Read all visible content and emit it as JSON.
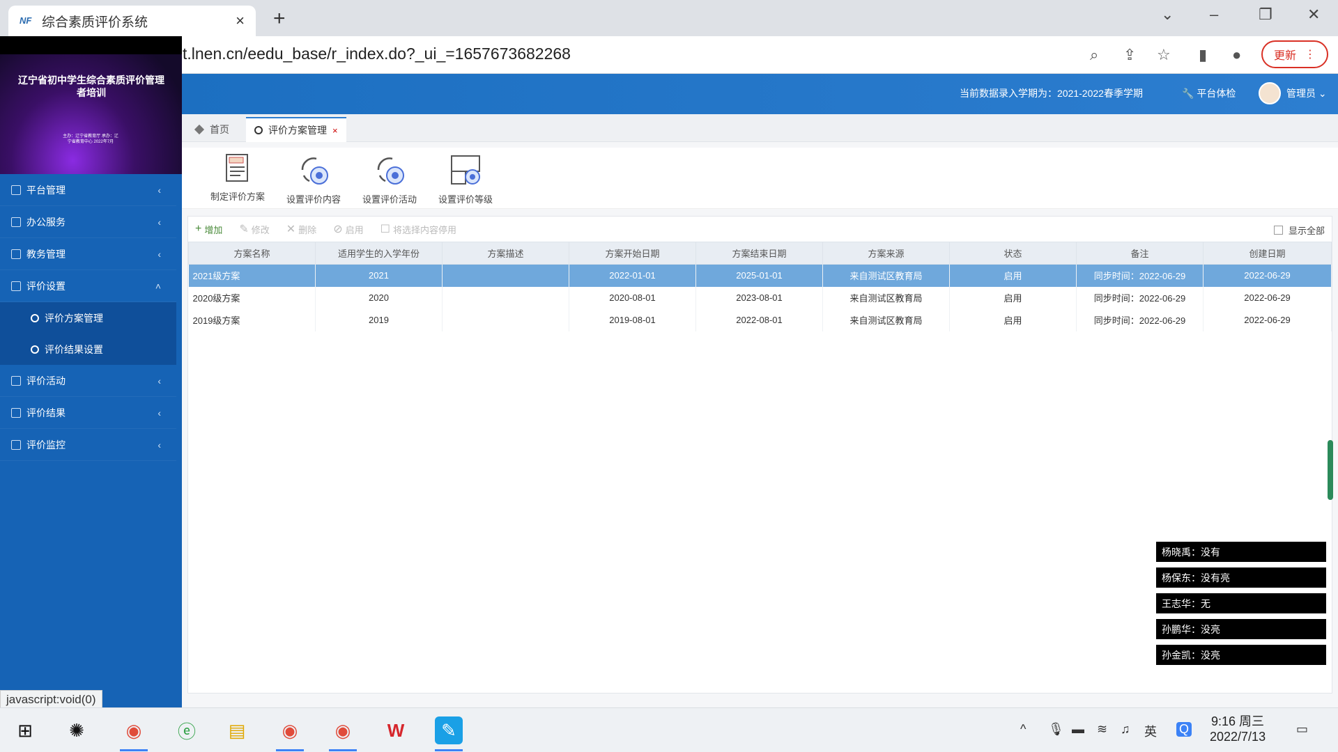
{
  "browser": {
    "tab_title": "综合素质评价系统",
    "tab_close": "×",
    "new_tab": "+",
    "url": "t.lnen.cn/eedu_base/r_index.do?_ui_=1657673682268",
    "update_label": "更新"
  },
  "video": {
    "title": "辽宁省初中学生综合素质评价管理者培训",
    "subtitle": "主办：辽宁省教育厅 承办：辽宁省教育中心 2022年7月"
  },
  "header": {
    "term_text": "当前数据录入学期为：2021-2022春季学期",
    "check_label": "平台体检",
    "user_label": "管理员"
  },
  "sidebar": {
    "items": [
      {
        "label": "平台管理",
        "chev": "‹"
      },
      {
        "label": "办公服务",
        "chev": "‹"
      },
      {
        "label": "教务管理",
        "chev": "‹"
      },
      {
        "label": "评价设置",
        "chev": "˄"
      },
      {
        "label": "评价活动",
        "chev": "‹"
      },
      {
        "label": "评价结果",
        "chev": "‹"
      },
      {
        "label": "评价监控",
        "chev": "‹"
      }
    ],
    "subitems": [
      {
        "label": "评价方案管理"
      },
      {
        "label": "评价结果设置"
      }
    ]
  },
  "content_tabs": {
    "home": "首页",
    "active": "评价方案管理",
    "close": "×"
  },
  "toolbar": {
    "items": [
      {
        "label": "制定评价方案",
        "icon": "plan-doc-icon"
      },
      {
        "label": "设置评价内容",
        "icon": "settings-cycle-icon"
      },
      {
        "label": "设置评价活动",
        "icon": "settings-cycle-icon"
      },
      {
        "label": "设置评价等级",
        "icon": "grade-settings-icon"
      }
    ]
  },
  "grid": {
    "add": "增加",
    "edit": "修改",
    "delete": "删除",
    "enable": "启用",
    "disable": "将选择内容停用",
    "show_all": "显示全部",
    "columns": [
      "方案名称",
      "适用学生的入学年份",
      "方案描述",
      "方案开始日期",
      "方案结束日期",
      "方案来源",
      "状态",
      "备注",
      "创建日期"
    ],
    "rows": [
      {
        "name": "2021级方案",
        "year": "2021",
        "desc": "",
        "start": "2022-01-01",
        "end": "2025-01-01",
        "source": "来自测试区教育局",
        "status": "启用",
        "note": "同步时间：2022-06-29",
        "created": "2022-06-29"
      },
      {
        "name": "2020级方案",
        "year": "2020",
        "desc": "",
        "start": "2020-08-01",
        "end": "2023-08-01",
        "source": "来自测试区教育局",
        "status": "启用",
        "note": "同步时间：2022-06-29",
        "created": "2022-06-29"
      },
      {
        "name": "2019级方案",
        "year": "2019",
        "desc": "",
        "start": "2019-08-01",
        "end": "2022-08-01",
        "source": "来自测试区教育局",
        "status": "启用",
        "note": "同步时间：2022-06-29",
        "created": "2022-06-29"
      }
    ]
  },
  "captions": [
    "杨晓禹：没有",
    "杨保东：没有亮",
    "王志华：无",
    "孙鹏华：没亮",
    "孙金凯：没亮"
  ],
  "status_url": "javascript:void(0)",
  "taskbar": {
    "time": "9:16 周三",
    "date": "2022/7/13"
  },
  "colors": {
    "sidebar": "#1663b5",
    "header": "#2d7ed0",
    "selected_row": "#6fa8dc",
    "update": "#d93025"
  }
}
